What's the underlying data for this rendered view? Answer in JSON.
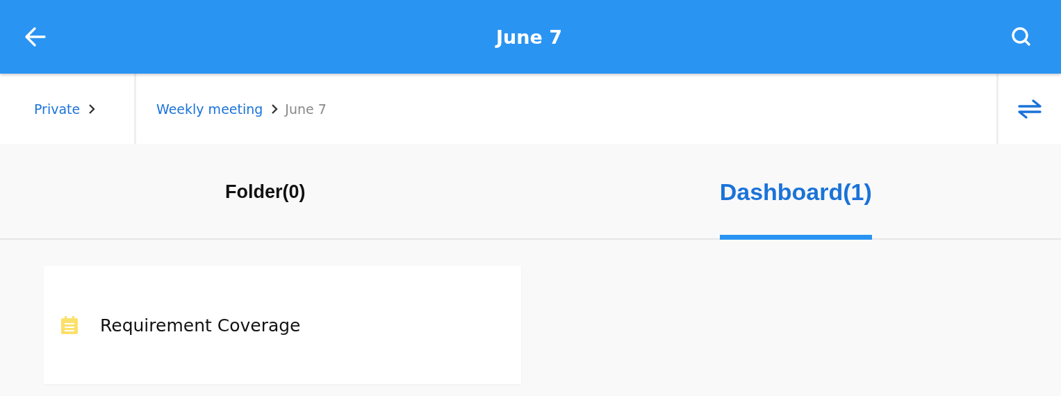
{
  "header": {
    "title": "June 7"
  },
  "breadcrumb": {
    "root": {
      "label": "Private"
    },
    "path": [
      {
        "label": "Weekly meeting",
        "current": false
      },
      {
        "label": "June 7",
        "current": true
      }
    ]
  },
  "tabs": [
    {
      "label": "Folder(0)",
      "selected": false
    },
    {
      "label": "Dashboard(1)",
      "selected": true
    }
  ],
  "items": [
    {
      "title": "Requirement Coverage"
    }
  ]
}
